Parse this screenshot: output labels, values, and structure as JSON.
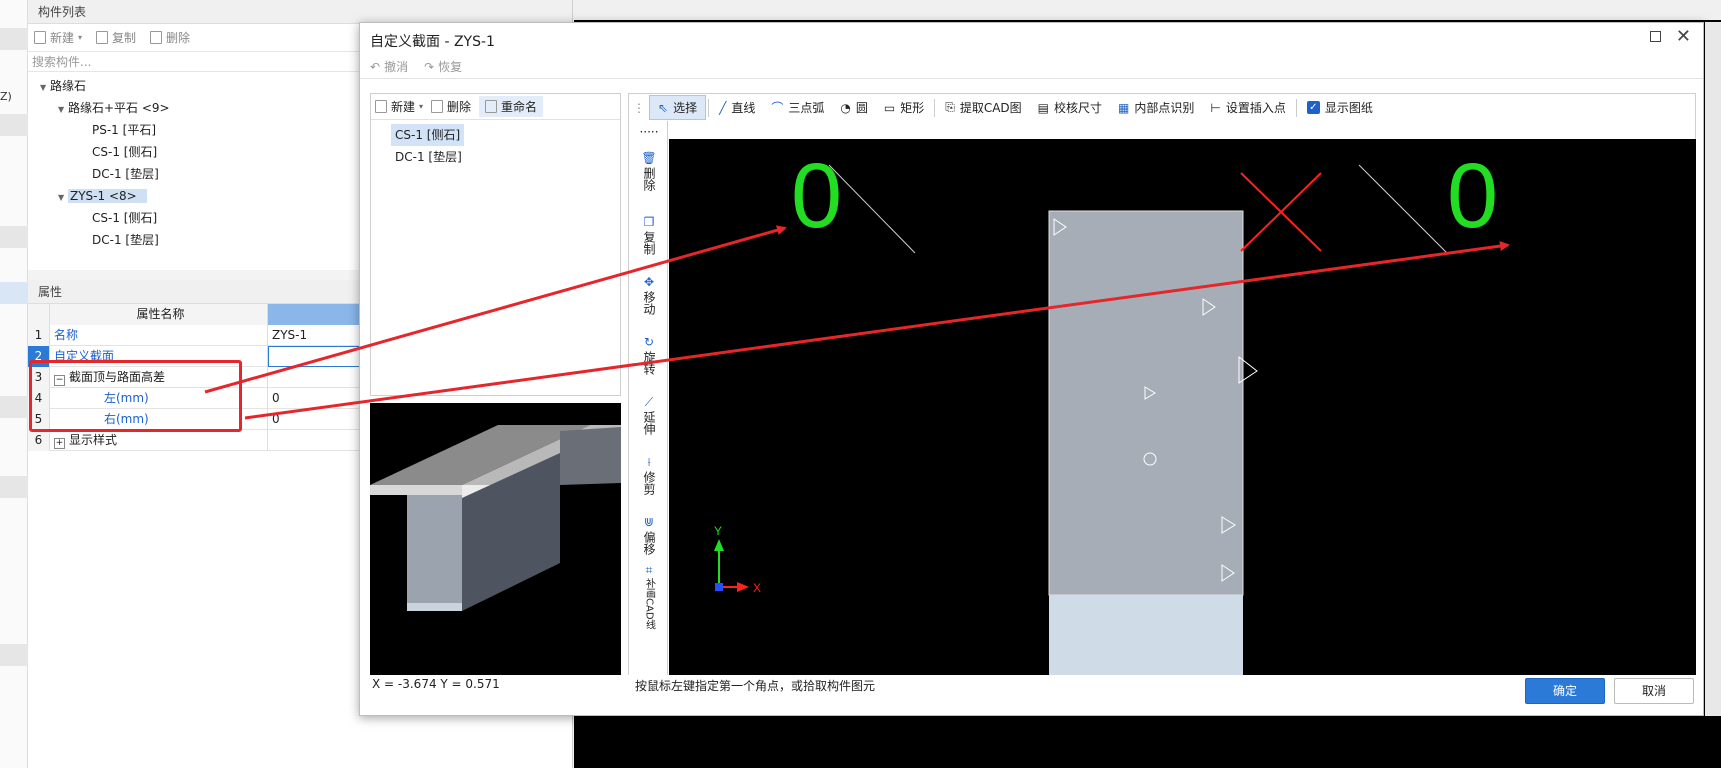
{
  "component_list": {
    "header": "构件列表",
    "toolbar": {
      "new": "新建",
      "copy": "复制",
      "delete": "删除"
    },
    "search_placeholder": "搜索构件...",
    "tree": {
      "root": "路缘石",
      "group1": "路缘石+平石 <9>",
      "group1_children": [
        "PS-1 [平石]",
        "CS-1 [侧石]",
        "DC-1 [垫层]"
      ],
      "group2": "ZYS-1 <8>",
      "group2_children": [
        "CS-1 [侧石]",
        "DC-1 [垫层]"
      ]
    }
  },
  "left_strip": {
    "label": "Z)"
  },
  "properties": {
    "header": "属性",
    "col_name": "属性名称",
    "rows": [
      {
        "num": "1",
        "name": "名称",
        "value": "ZYS-1"
      },
      {
        "num": "2",
        "name": "自定义截面",
        "value": ""
      },
      {
        "num": "3",
        "name": "截面顶与路面高差",
        "value": ""
      },
      {
        "num": "4",
        "name": "左(mm)",
        "value": "0"
      },
      {
        "num": "5",
        "name": "右(mm)",
        "value": "0"
      },
      {
        "num": "6",
        "name": "显示样式",
        "value": ""
      }
    ]
  },
  "dialog": {
    "title": "自定义截面 - ZYS-1",
    "undo": "撤消",
    "redo": "恢复",
    "left_toolbar": {
      "new": "新建",
      "delete": "删除",
      "rename": "重命名"
    },
    "list": [
      "CS-1 [侧石]",
      "DC-1 [垫层]"
    ],
    "toolbar": {
      "select": "选择",
      "line": "直线",
      "arc": "三点弧",
      "circle": "圆",
      "rect": "矩形",
      "extract_cad": "提取CAD图",
      "check_size": "校核尺寸",
      "inner_point": "内部点识别",
      "insert_point": "设置插入点",
      "show_drawing": "显示图纸"
    },
    "side_tools": [
      "删除",
      "复制",
      "移动",
      "旋转",
      "延伸",
      "修剪",
      "偏移",
      "补画CAD线"
    ],
    "coords": "X = -3.674 Y = 0.571",
    "status": "按鼠标左键指定第一个角点，或拾取构件图元",
    "ok": "确定",
    "cancel": "取消"
  },
  "canvas": {
    "left_number": "0",
    "right_number": "0",
    "axis_y": "Y",
    "axis_x": "X"
  },
  "colors": {
    "annotation_red": "#e5262b",
    "digit_green": "#22dd22",
    "accent_blue": "#2b7ad8"
  }
}
